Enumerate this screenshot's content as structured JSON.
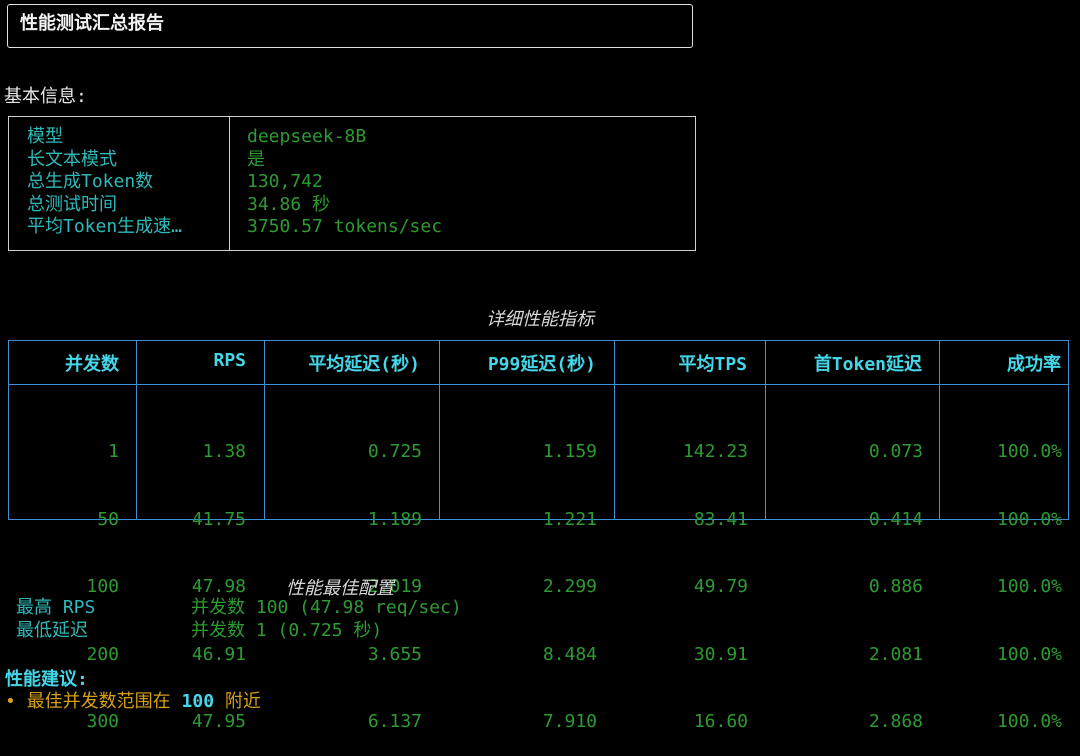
{
  "title": "性能测试汇总报告",
  "basic_info": {
    "label": "基本信息:",
    "rows": [
      {
        "key": "模型",
        "value": "deepseek-8B"
      },
      {
        "key": "长文本模式",
        "value": "是"
      },
      {
        "key": "总生成Token数",
        "value": "130,742"
      },
      {
        "key": "总测试时间",
        "value": "34.86 秒"
      },
      {
        "key": "平均Token生成速…",
        "value": "3750.57 tokens/sec"
      }
    ]
  },
  "perf_table": {
    "caption": "详细性能指标",
    "headers": [
      "并发数",
      "RPS",
      "平均延迟(秒)",
      "P99延迟(秒)",
      "平均TPS",
      "首Token延迟",
      "成功率"
    ],
    "rows": [
      [
        "1",
        "1.38",
        "0.725",
        "1.159",
        "142.23",
        "0.073",
        "100.0%"
      ],
      [
        "50",
        "41.75",
        "1.189",
        "1.221",
        "83.41",
        "0.414",
        "100.0%"
      ],
      [
        "100",
        "47.98",
        "2.019",
        "2.299",
        "49.79",
        "0.886",
        "100.0%"
      ],
      [
        "200",
        "46.91",
        "3.655",
        "8.484",
        "30.91",
        "2.081",
        "100.0%"
      ],
      [
        "300",
        "47.95",
        "6.137",
        "7.910",
        "16.60",
        "2.868",
        "100.0%"
      ]
    ]
  },
  "best_config": {
    "caption": "性能最佳配置",
    "rows": [
      {
        "key": "最高 RPS",
        "value": "并发数 100 (47.98 req/sec)"
      },
      {
        "key": "最低延迟",
        "value": "并发数 1 (0.725 秒)"
      }
    ]
  },
  "advice": {
    "title": "性能建议:",
    "bullet": "•",
    "prefix": "最佳并发数范围在",
    "number": "100",
    "suffix": "附近"
  },
  "colors": {
    "key_cyan": "#2fb8b8",
    "value_green": "#2e9a32",
    "header_cyan": "#45d6e8",
    "border_blue": "#3d8fd6",
    "advice_yellow": "#d4a017"
  }
}
